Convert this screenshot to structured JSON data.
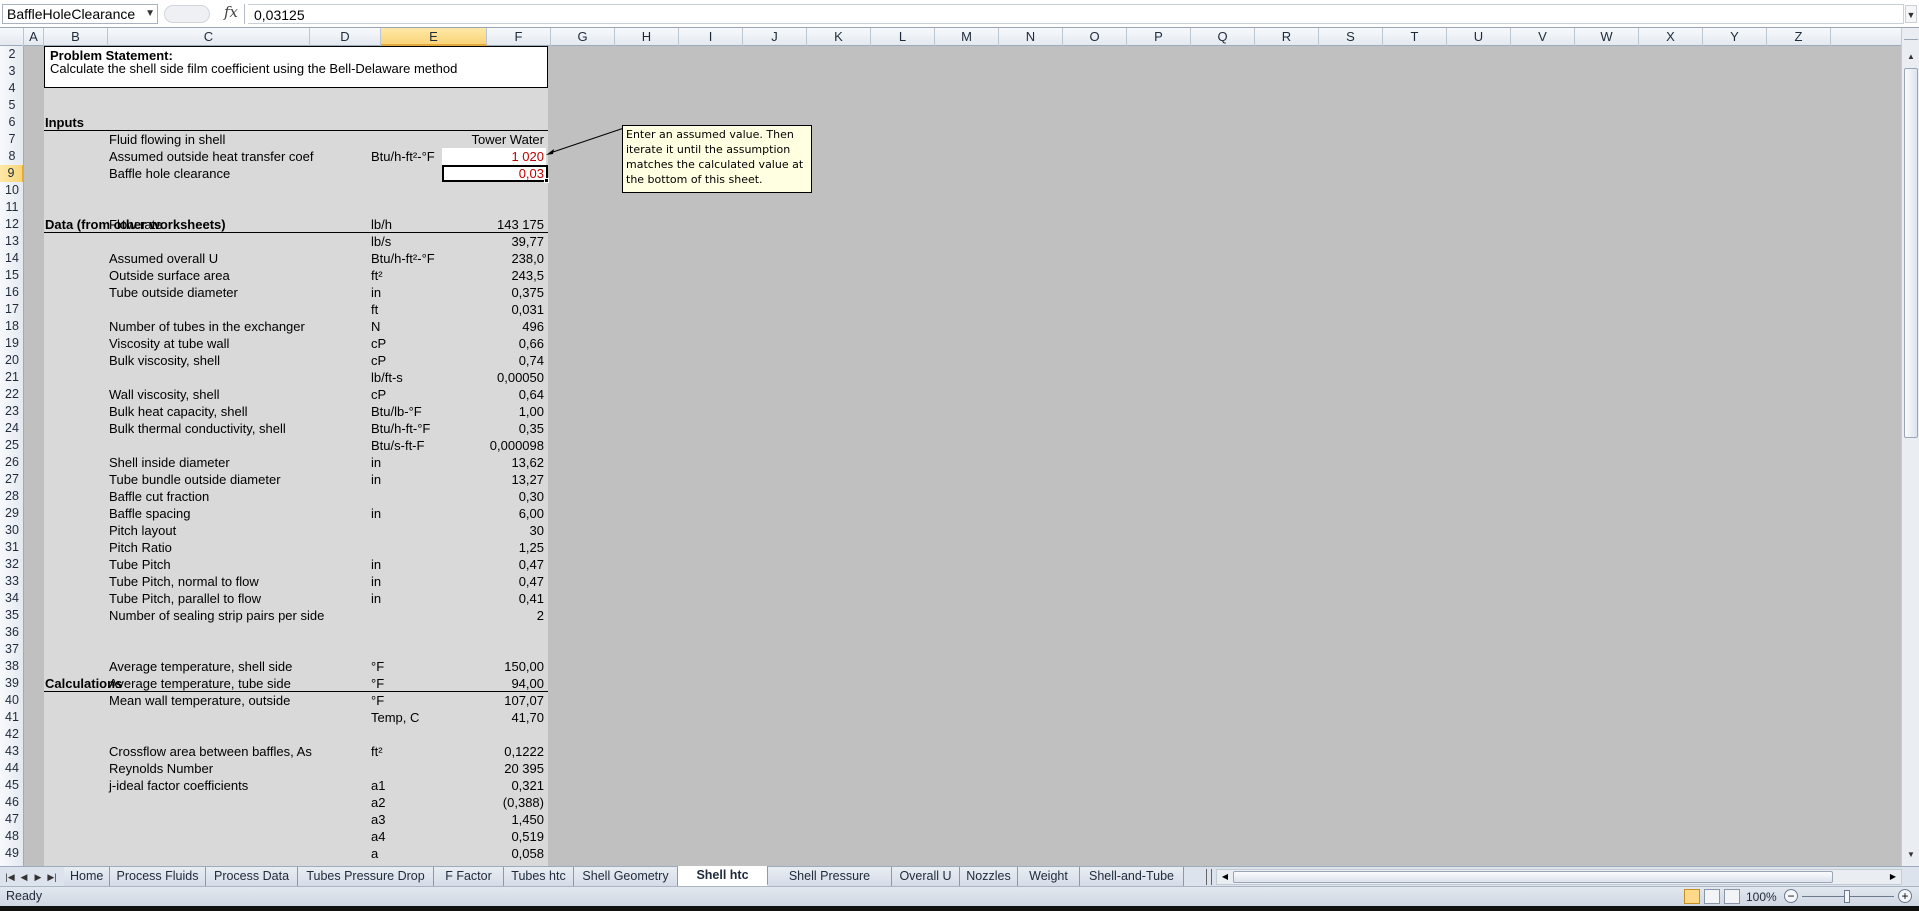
{
  "formula_bar": {
    "name_box": "BaffleHoleClearance",
    "fx_label": "fx",
    "formula": "0,03125"
  },
  "columns": [
    "A",
    "B",
    "C",
    "D",
    "E",
    "F",
    "G",
    "H",
    "I",
    "J",
    "K",
    "L",
    "M",
    "N",
    "O",
    "P",
    "Q",
    "R",
    "S",
    "T",
    "U",
    "V",
    "W",
    "X",
    "Y",
    "Z"
  ],
  "selected_column": "E",
  "row_numbers": [
    "2",
    "3",
    "4",
    "5",
    "6",
    "7",
    "8",
    "9",
    "10",
    "11",
    "12",
    "13",
    "14",
    "15",
    "16",
    "17",
    "18",
    "19",
    "20",
    "21",
    "22",
    "23",
    "24",
    "25",
    "26",
    "27",
    "28",
    "29",
    "30",
    "31",
    "32",
    "33",
    "34",
    "35",
    "36",
    "37",
    "38",
    "39",
    "40",
    "41",
    "42",
    "43",
    "44",
    "45",
    "46",
    "47",
    "48",
    "49"
  ],
  "selected_row": "9",
  "problem": {
    "title": "Problem Statement:",
    "text": "Calculate  the  shell  side  film  coefficient  using  the  Bell-Delaware  method"
  },
  "sections": {
    "inputs": "Inputs",
    "data": "Data (from other worksheets)",
    "calculations": "Calculations"
  },
  "rows": [
    {
      "r": "7",
      "c": "Fluid flowing in shell",
      "d": "",
      "e": "Tower Water"
    },
    {
      "r": "8",
      "c": "Assumed outside heat transfer coef",
      "d": "Btu/h-ft²-°F",
      "e": "1 020",
      "red": true,
      "white": true
    },
    {
      "r": "9",
      "c": "Baffle hole clearance",
      "d": "",
      "e": "0,03",
      "red": true,
      "white": true
    },
    {
      "r": "12",
      "c": "Flow rate",
      "d": "lb/h",
      "e": "143 175"
    },
    {
      "r": "13",
      "c": "",
      "d": "lb/s",
      "e": "39,77"
    },
    {
      "r": "14",
      "c": "Assumed overall U",
      "d": "Btu/h-ft²-°F",
      "e": "238,0"
    },
    {
      "r": "15",
      "c": "Outside surface area",
      "d": "ft²",
      "e": "243,5"
    },
    {
      "r": "16",
      "c": "Tube outside diameter",
      "d": "in",
      "e": "0,375"
    },
    {
      "r": "17",
      "c": "",
      "d": "ft",
      "e": "0,031"
    },
    {
      "r": "18",
      "c": "Number of tubes in the exchanger",
      "d": "N",
      "e": "496"
    },
    {
      "r": "19",
      "c": "Viscosity at tube wall",
      "d": "cP",
      "e": "0,66"
    },
    {
      "r": "20",
      "c": "Bulk viscosity, shell",
      "d": "cP",
      "e": "0,74"
    },
    {
      "r": "21",
      "c": "",
      "d": "lb/ft-s",
      "e": "0,00050"
    },
    {
      "r": "22",
      "c": "Wall viscosity, shell",
      "d": "cP",
      "e": "0,64"
    },
    {
      "r": "23",
      "c": "Bulk heat capacity, shell",
      "d": "Btu/lb-°F",
      "e": "1,00"
    },
    {
      "r": "24",
      "c": "Bulk thermal conductivity, shell",
      "d": "Btu/h-ft-°F",
      "e": "0,35"
    },
    {
      "r": "25",
      "c": "",
      "d": "Btu/s-ft-F",
      "e": "0,000098"
    },
    {
      "r": "26",
      "c": "Shell inside diameter",
      "d": "in",
      "e": "13,62"
    },
    {
      "r": "27",
      "c": "Tube bundle outside diameter",
      "d": "in",
      "e": "13,27"
    },
    {
      "r": "28",
      "c": "Baffle cut fraction",
      "d": "",
      "e": "0,30"
    },
    {
      "r": "29",
      "c": "Baffle spacing",
      "d": "in",
      "e": "6,00"
    },
    {
      "r": "30",
      "c": "Pitch layout",
      "d": "",
      "e": "30"
    },
    {
      "r": "31",
      "c": "Pitch Ratio",
      "d": "",
      "e": "1,25"
    },
    {
      "r": "32",
      "c": "Tube Pitch",
      "d": "in",
      "e": "0,47"
    },
    {
      "r": "33",
      "c": "Tube Pitch, normal to flow",
      "d": "in",
      "e": "0,47"
    },
    {
      "r": "34",
      "c": "Tube Pitch, parallel to flow",
      "d": "in",
      "e": "0,41"
    },
    {
      "r": "35",
      "c": "Number of sealing strip pairs per side",
      "d": "",
      "e": "2"
    },
    {
      "r": "38",
      "c": "Average temperature, shell side",
      "d": "°F",
      "e": "150,00"
    },
    {
      "r": "39",
      "c": "Average temperature, tube side",
      "d": "°F",
      "e": "94,00"
    },
    {
      "r": "40",
      "c": "Mean wall temperature, outside",
      "d": "°F",
      "e": "107,07"
    },
    {
      "r": "41",
      "c": "",
      "d": "Temp, C",
      "e": "41,70"
    },
    {
      "r": "43",
      "c": "Crossflow area between baffles, As",
      "d": "ft²",
      "e": "0,1222"
    },
    {
      "r": "44",
      "c": "Reynolds Number",
      "d": "",
      "e": "20 395"
    },
    {
      "r": "45",
      "c": "j-ideal factor coefficients",
      "d": "a1",
      "e": "0,321"
    },
    {
      "r": "46",
      "c": "",
      "d": "a2",
      "e": "(0,388)"
    },
    {
      "r": "47",
      "c": "",
      "d": "a3",
      "e": "1,450"
    },
    {
      "r": "48",
      "c": "",
      "d": "a4",
      "e": "0,519"
    },
    {
      "r": "49",
      "c": "",
      "d": "a",
      "e": "0,058"
    }
  ],
  "comment": "Enter an assumed value. Then iterate it until the assumption matches the calculated value at the bottom of this sheet.",
  "tabs": [
    "Home",
    "Process Fluids",
    "Process Data",
    "Tubes Pressure Drop",
    "F Factor",
    "Tubes htc",
    "Shell Geometry",
    "Shell htc",
    "Shell Pressure Drop",
    "Overall U",
    "Nozzles",
    "Weight",
    "Shell-and-Tube"
  ],
  "active_tab": "Shell htc",
  "status": {
    "ready": "Ready",
    "zoom": "100%"
  }
}
